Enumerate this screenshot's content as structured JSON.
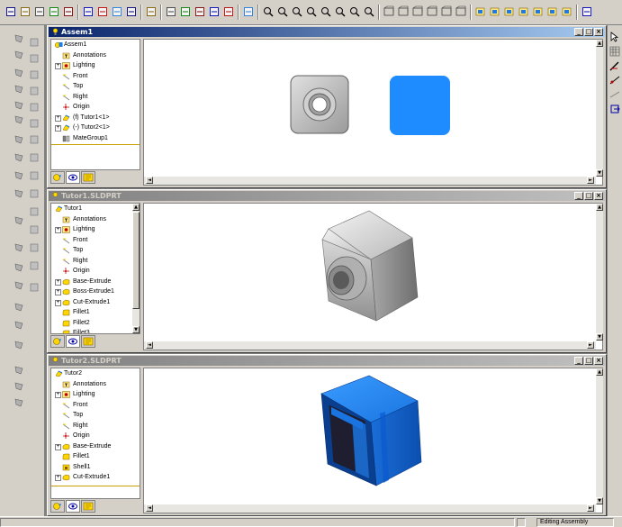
{
  "toolbar": {
    "buttons": [
      {
        "name": "new-icon"
      },
      {
        "name": "open-icon"
      },
      {
        "name": "save-icon"
      },
      {
        "name": "print-icon"
      },
      {
        "name": "print-preview-icon"
      },
      {
        "name": "cut-icon"
      },
      {
        "name": "copy-icon"
      },
      {
        "name": "paste-icon"
      },
      {
        "name": "delete-icon"
      },
      {
        "name": "undo-icon"
      },
      {
        "name": "rebuild-icon"
      },
      {
        "name": "select-icon"
      },
      {
        "name": "grid-icon"
      },
      {
        "name": "options-icon"
      },
      {
        "name": "color-icon"
      },
      {
        "name": "help-icon"
      },
      {
        "name": "view-orientation-icon"
      },
      {
        "name": "previous-view-icon"
      },
      {
        "name": "zoom-fit-icon"
      },
      {
        "name": "zoom-area-icon"
      },
      {
        "name": "zoom-inout-icon"
      },
      {
        "name": "zoom-selection-icon"
      },
      {
        "name": "rotate-icon"
      },
      {
        "name": "pan-icon"
      },
      {
        "name": "wireframe-icon"
      },
      {
        "name": "hidden-lines-visible-icon"
      },
      {
        "name": "hidden-lines-removed-icon"
      },
      {
        "name": "shaded-edges-icon"
      },
      {
        "name": "shaded-icon"
      },
      {
        "name": "shadows-icon"
      },
      {
        "name": "view-front-icon"
      },
      {
        "name": "view-back-icon"
      },
      {
        "name": "view-left-icon"
      },
      {
        "name": "view-right-icon"
      },
      {
        "name": "view-top-icon"
      },
      {
        "name": "view-bottom-icon"
      },
      {
        "name": "view-iso-icon"
      },
      {
        "name": "normal-to-icon"
      }
    ]
  },
  "windows": [
    {
      "title": "Assem1",
      "active": true,
      "tree": [
        {
          "label": "Assem1",
          "icon": "assembly",
          "level": 0
        },
        {
          "label": "Annotations",
          "icon": "annotation",
          "level": 1
        },
        {
          "label": "Lighting",
          "icon": "lighting",
          "level": 1,
          "expandable": true
        },
        {
          "label": "Front",
          "icon": "plane",
          "level": 1
        },
        {
          "label": "Top",
          "icon": "plane",
          "level": 1
        },
        {
          "label": "Right",
          "icon": "plane",
          "level": 1
        },
        {
          "label": "Origin",
          "icon": "origin",
          "level": 1
        },
        {
          "label": "(f) Tutor1<1>",
          "icon": "part",
          "level": 1,
          "expandable": true
        },
        {
          "label": "(-) Tutor2<1>",
          "icon": "part",
          "level": 1,
          "expandable": true
        },
        {
          "label": "MateGroup1",
          "icon": "mate",
          "level": 1
        }
      ]
    },
    {
      "title": "Tutor1.SLDPRT",
      "active": false,
      "tree": [
        {
          "label": "Tutor1",
          "icon": "part",
          "level": 0
        },
        {
          "label": "Annotations",
          "icon": "annotation",
          "level": 1
        },
        {
          "label": "Lighting",
          "icon": "lighting",
          "level": 1,
          "expandable": true
        },
        {
          "label": "Front",
          "icon": "plane",
          "level": 1
        },
        {
          "label": "Top",
          "icon": "plane",
          "level": 1
        },
        {
          "label": "Right",
          "icon": "plane",
          "level": 1
        },
        {
          "label": "Origin",
          "icon": "origin",
          "level": 1
        },
        {
          "label": "Base-Extrude",
          "icon": "feature",
          "level": 1,
          "expandable": true
        },
        {
          "label": "Boss-Extrude1",
          "icon": "feature",
          "level": 1,
          "expandable": true
        },
        {
          "label": "Cut-Extrude1",
          "icon": "feature",
          "level": 1,
          "expandable": true
        },
        {
          "label": "Fillet1",
          "icon": "fillet",
          "level": 1
        },
        {
          "label": "Fillet2",
          "icon": "fillet",
          "level": 1
        },
        {
          "label": "Fillet3",
          "icon": "fillet",
          "level": 1
        }
      ]
    },
    {
      "title": "Tutor2.SLDPRT",
      "active": false,
      "tree": [
        {
          "label": "Tutor2",
          "icon": "part",
          "level": 0
        },
        {
          "label": "Annotations",
          "icon": "annotation",
          "level": 1
        },
        {
          "label": "Lighting",
          "icon": "lighting",
          "level": 1,
          "expandable": true
        },
        {
          "label": "Front",
          "icon": "plane",
          "level": 1
        },
        {
          "label": "Top",
          "icon": "plane",
          "level": 1
        },
        {
          "label": "Right",
          "icon": "plane",
          "level": 1
        },
        {
          "label": "Origin",
          "icon": "origin",
          "level": 1
        },
        {
          "label": "Base-Extrude",
          "icon": "feature",
          "level": 1,
          "expandable": true
        },
        {
          "label": "Fillet1",
          "icon": "fillet",
          "level": 1
        },
        {
          "label": "Shell1",
          "icon": "shell",
          "level": 1
        },
        {
          "label": "Cut-Extrude1",
          "icon": "feature",
          "level": 1,
          "expandable": true
        }
      ]
    }
  ],
  "status": {
    "message": "Editing Assembly"
  },
  "colors": {
    "active_title": "#0a246a",
    "inactive_title": "#808080",
    "part_blue": "#1e7be0",
    "part_gray": "#9a9a9a"
  }
}
